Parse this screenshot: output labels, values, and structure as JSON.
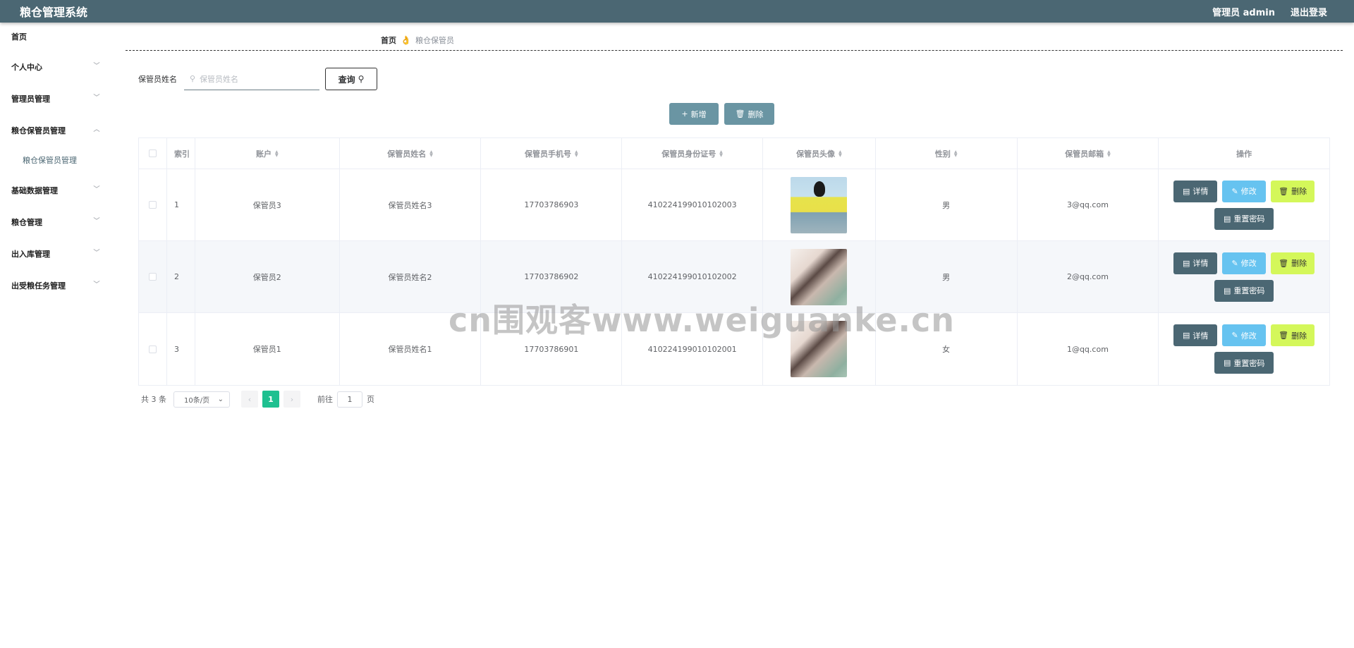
{
  "header": {
    "title": "粮仓管理系统",
    "user": "管理员 admin",
    "logout": "退出登录"
  },
  "sidebar": {
    "items": [
      {
        "label": "首页"
      },
      {
        "label": "个人中心"
      },
      {
        "label": "管理员管理"
      },
      {
        "label": "粮仓保管员管理"
      },
      {
        "label": "基础数据管理"
      },
      {
        "label": "粮仓管理"
      },
      {
        "label": "出入库管理"
      },
      {
        "label": "出受粮任务管理"
      }
    ],
    "subitem": "粮仓保管员管理"
  },
  "breadcrumb": {
    "home": "首页",
    "current": "粮仓保管员"
  },
  "search": {
    "label": "保管员姓名",
    "placeholder": "保管员姓名",
    "button": "查询"
  },
  "actions": {
    "add": "新增",
    "delete": "删除"
  },
  "table": {
    "headers": [
      "索引",
      "账户",
      "保管员姓名",
      "保管员手机号",
      "保管员身份证号",
      "保管员头像",
      "性别",
      "保管员邮箱",
      "操作"
    ],
    "rows": [
      {
        "index": "1",
        "account": "保管员3",
        "name": "保管员姓名3",
        "phone": "17703786903",
        "idcard": "410224199010102003",
        "gender": "男",
        "email": "3@qq.com"
      },
      {
        "index": "2",
        "account": "保管员2",
        "name": "保管员姓名2",
        "phone": "17703786902",
        "idcard": "410224199010102002",
        "gender": "男",
        "email": "2@qq.com"
      },
      {
        "index": "3",
        "account": "保管员1",
        "name": "保管员姓名1",
        "phone": "17703786901",
        "idcard": "410224199010102001",
        "gender": "女",
        "email": "1@qq.com"
      }
    ],
    "ops": {
      "detail": "详情",
      "edit": "修改",
      "remove": "删除",
      "reset": "重置密码"
    }
  },
  "pagination": {
    "total": "共 3 条",
    "page_size": "10条/页",
    "current_page": "1",
    "goto_label": "前往",
    "goto_value": "1",
    "page_suffix": "页"
  },
  "watermark": "cn围观客www.weiguanke.cn"
}
